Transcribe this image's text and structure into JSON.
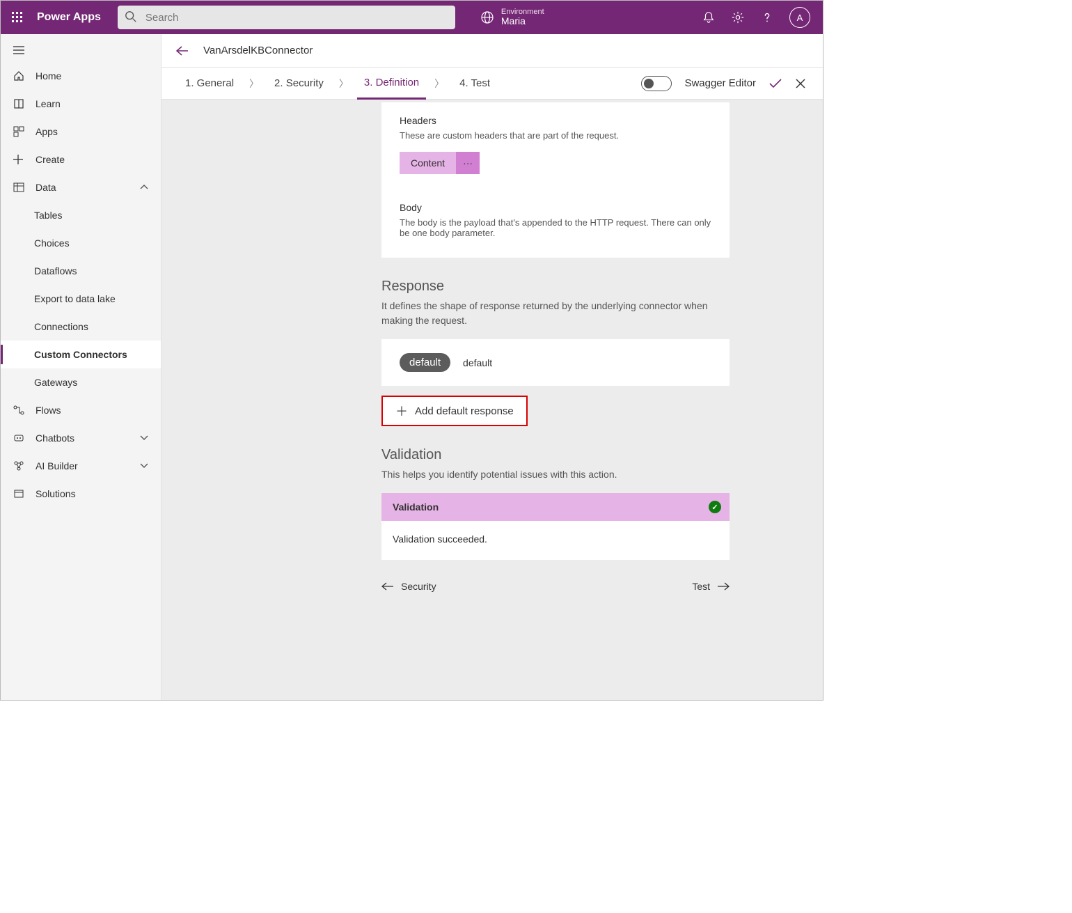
{
  "header": {
    "brand": "Power Apps",
    "search_placeholder": "Search",
    "env_label": "Environment",
    "env_name": "Maria",
    "avatar_initial": "A"
  },
  "sidenav": {
    "items": {
      "home": "Home",
      "learn": "Learn",
      "apps": "Apps",
      "create": "Create",
      "data": "Data",
      "flows": "Flows",
      "chatbots": "Chatbots",
      "ai": "AI Builder",
      "solutions": "Solutions"
    },
    "data_sub": {
      "tables": "Tables",
      "choices": "Choices",
      "dataflows": "Dataflows",
      "export": "Export to data lake",
      "connections": "Connections",
      "custom": "Custom Connectors",
      "gateways": "Gateways"
    }
  },
  "page": {
    "title": "VanArsdelKBConnector",
    "tabs": {
      "general": "1. General",
      "security": "2. Security",
      "definition": "3. Definition",
      "test": "4. Test"
    },
    "swagger_label": "Swagger Editor"
  },
  "headers_section": {
    "title": "Headers",
    "desc": "These are custom headers that are part of the request.",
    "chip": "Content",
    "chip_more": "···"
  },
  "body_section": {
    "title": "Body",
    "desc": "The body is the payload that's appended to the HTTP request. There can only be one body parameter."
  },
  "response": {
    "title": "Response",
    "desc": "It defines the shape of response returned by the underlying connector when making the request.",
    "badge": "default",
    "label": "default",
    "add_btn": "Add default response"
  },
  "validation": {
    "title": "Validation",
    "desc": "This helps you identify potential issues with this action.",
    "header": "Validation",
    "body": "Validation succeeded."
  },
  "footer": {
    "prev": "Security",
    "next": "Test"
  }
}
